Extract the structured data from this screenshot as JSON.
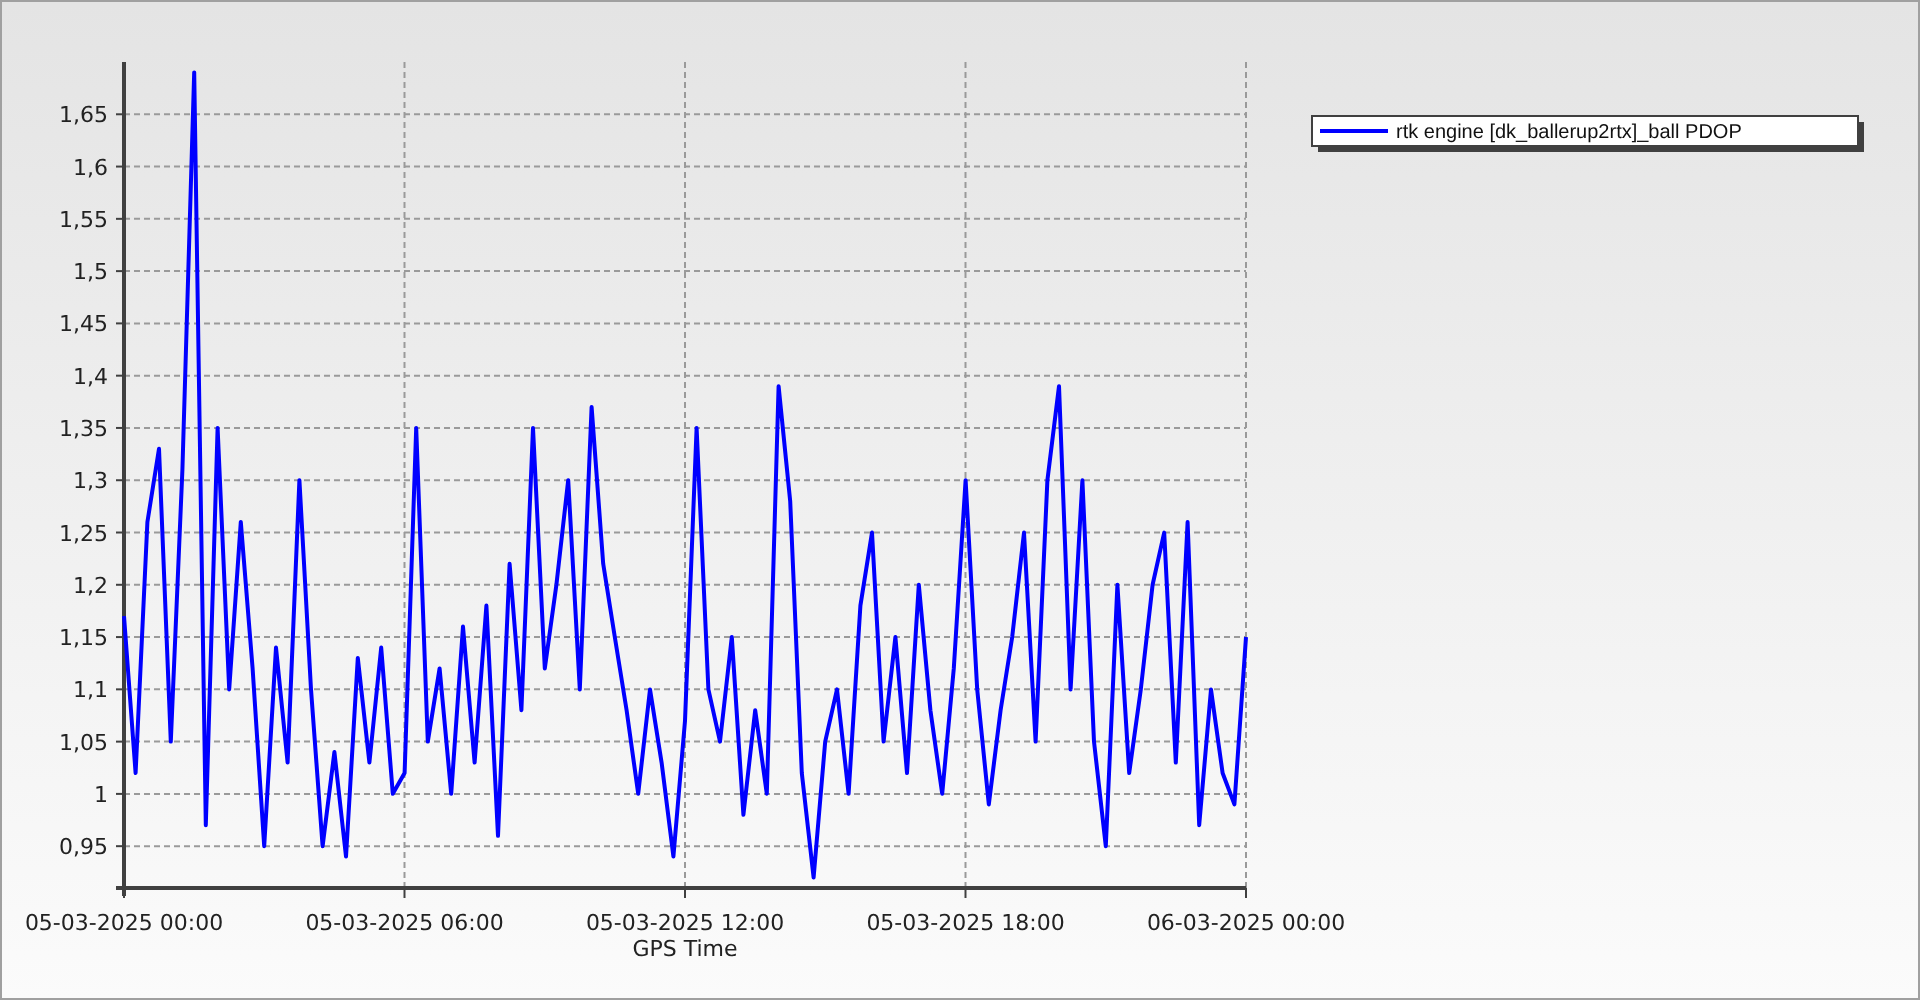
{
  "chart": {
    "chart_data": {
      "type": "line",
      "grid": true,
      "xlabel": "GPS Time",
      "ylim": [
        0.91,
        1.7
      ],
      "categories": [
        "05-03-2025 00:00",
        null,
        null,
        null,
        null,
        null,
        null,
        null,
        null,
        null,
        null,
        null,
        null,
        null,
        null,
        null,
        null,
        null,
        null,
        null,
        null,
        null,
        null,
        null,
        "05-03-2025 06:00",
        null,
        null,
        null,
        null,
        null,
        null,
        null,
        null,
        null,
        null,
        null,
        null,
        null,
        null,
        null,
        null,
        null,
        null,
        null,
        null,
        null,
        null,
        null,
        "05-03-2025 12:00",
        null,
        null,
        null,
        null,
        null,
        null,
        null,
        null,
        null,
        null,
        null,
        null,
        null,
        null,
        null,
        null,
        null,
        null,
        null,
        null,
        null,
        null,
        null,
        "05-03-2025 18:00",
        null,
        null,
        null,
        null,
        null,
        null,
        null,
        null,
        null,
        null,
        null,
        null,
        null,
        null,
        null,
        null,
        null,
        null,
        null,
        null,
        null,
        null,
        null,
        "06-03-2025 00:00"
      ],
      "yticks": [
        {
          "value": 0.95,
          "label": "0,95"
        },
        {
          "value": 1,
          "label": "1"
        },
        {
          "value": 1.05,
          "label": "1,05"
        },
        {
          "value": 1.1,
          "label": "1,1"
        },
        {
          "value": 1.15,
          "label": "1,15"
        },
        {
          "value": 1.2,
          "label": "1,2"
        },
        {
          "value": 1.25,
          "label": "1,25"
        },
        {
          "value": 1.3,
          "label": "1,3"
        },
        {
          "value": 1.35,
          "label": "1,35"
        },
        {
          "value": 1.4,
          "label": "1,4"
        },
        {
          "value": 1.45,
          "label": "1,45"
        },
        {
          "value": 1.5,
          "label": "1,5"
        },
        {
          "value": 1.55,
          "label": "1,55"
        },
        {
          "value": 1.6,
          "label": "1,6"
        },
        {
          "value": 1.65,
          "label": "1,65"
        }
      ],
      "series": [
        {
          "name": "rtk engine [dk_ballerup2rtx]_ball PDOP",
          "color": "#0000ff",
          "values": [
            1.17,
            1.02,
            1.26,
            1.33,
            1.05,
            1.31,
            1.69,
            0.97,
            1.35,
            1.1,
            1.26,
            1.12,
            0.95,
            1.14,
            1.03,
            1.3,
            1.1,
            0.95,
            1.04,
            0.94,
            1.13,
            1.03,
            1.14,
            1,
            1.02,
            1.35,
            1.05,
            1.12,
            1,
            1.16,
            1.03,
            1.18,
            0.96,
            1.22,
            1.08,
            1.35,
            1.12,
            1.2,
            1.3,
            1.1,
            1.37,
            1.22,
            1.15,
            1.08,
            1,
            1.1,
            1.03,
            0.94,
            1.07,
            1.35,
            1.1,
            1.05,
            1.15,
            0.98,
            1.08,
            1,
            1.39,
            1.28,
            1.02,
            0.92,
            1.05,
            1.1,
            1,
            1.18,
            1.25,
            1.05,
            1.15,
            1.02,
            1.2,
            1.08,
            1,
            1.12,
            1.3,
            1.1,
            0.99,
            1.08,
            1.15,
            1.25,
            1.05,
            1.3,
            1.39,
            1.1,
            1.3,
            1.05,
            0.95,
            1.2,
            1.02,
            1.1,
            1.2,
            1.25,
            1.03,
            1.26,
            0.97,
            1.1,
            1.02,
            0.99,
            1.15
          ]
        }
      ]
    }
  }
}
